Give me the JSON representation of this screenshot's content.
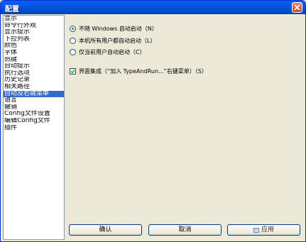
{
  "window": {
    "title": "配置"
  },
  "sidebar": {
    "items": [
      {
        "label": "显示",
        "selected": false
      },
      {
        "label": "命令行外观",
        "selected": false
      },
      {
        "label": "显示提示",
        "selected": false
      },
      {
        "label": "下拉列表",
        "selected": false
      },
      {
        "label": "颜色",
        "selected": false
      },
      {
        "label": "字体",
        "selected": false
      },
      {
        "label": "热键",
        "selected": false
      },
      {
        "label": "自动提示",
        "selected": false
      },
      {
        "label": "执行选项",
        "selected": false
      },
      {
        "label": "历史记录",
        "selected": false
      },
      {
        "label": "相关路径",
        "selected": false
      },
      {
        "label": "自动及右键菜单",
        "selected": true
      },
      {
        "label": "语言",
        "selected": false
      },
      {
        "label": "撤销",
        "selected": false
      },
      {
        "label": "Config文件设置",
        "selected": false
      },
      {
        "label": "编辑Config文件",
        "selected": false
      },
      {
        "label": "插件",
        "selected": false
      }
    ]
  },
  "options": {
    "radio1": {
      "label": "不随 Windows 自动启动（N）",
      "checked": true
    },
    "radio2": {
      "label": "本机所有用户都自动启动（L）",
      "checked": false
    },
    "radio3": {
      "label": "仅当前用户自动启动（C）",
      "checked": false
    },
    "checkbox1": {
      "label": "界面集成（“加入 TypeAndRun...”右键菜单）（S）",
      "checked": true
    }
  },
  "buttons": {
    "ok": "确认",
    "cancel": "取消",
    "apply": "应用"
  }
}
